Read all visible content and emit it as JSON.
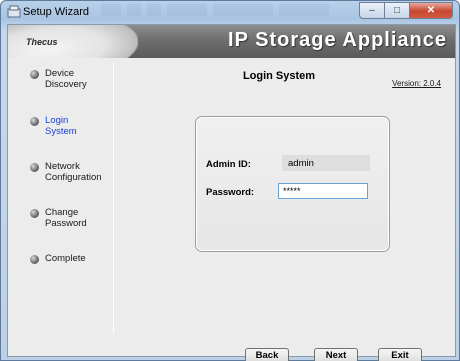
{
  "window": {
    "title": "Setup Wizard",
    "controls": {
      "minimize": "–",
      "maximize": "□",
      "close": "✕"
    }
  },
  "banner": {
    "logo": "Thecus",
    "title": "IP Storage Appliance"
  },
  "sidebar": {
    "steps": [
      {
        "label_line1": "Device",
        "label_line2": "Discovery",
        "active": false
      },
      {
        "label_line1": "Login",
        "label_line2": "System",
        "active": true
      },
      {
        "label_line1": "Network",
        "label_line2": "Configuration",
        "active": false
      },
      {
        "label_line1": "Change",
        "label_line2": "Password",
        "active": false
      },
      {
        "label_line1": "Complete",
        "label_line2": "",
        "active": false
      }
    ]
  },
  "main": {
    "title": "Login System",
    "version": "Version: 2.0.4",
    "form": {
      "admin_label": "Admin ID:",
      "admin_value": "admin",
      "password_label": "Password:",
      "password_value": "*****"
    }
  },
  "buttons": {
    "back": "Back",
    "next": "Next",
    "exit": "Exit"
  },
  "colors": {
    "active_step": "#1b3fd6",
    "close_button": "#c7462f",
    "focus_border": "#6aa2d8"
  }
}
